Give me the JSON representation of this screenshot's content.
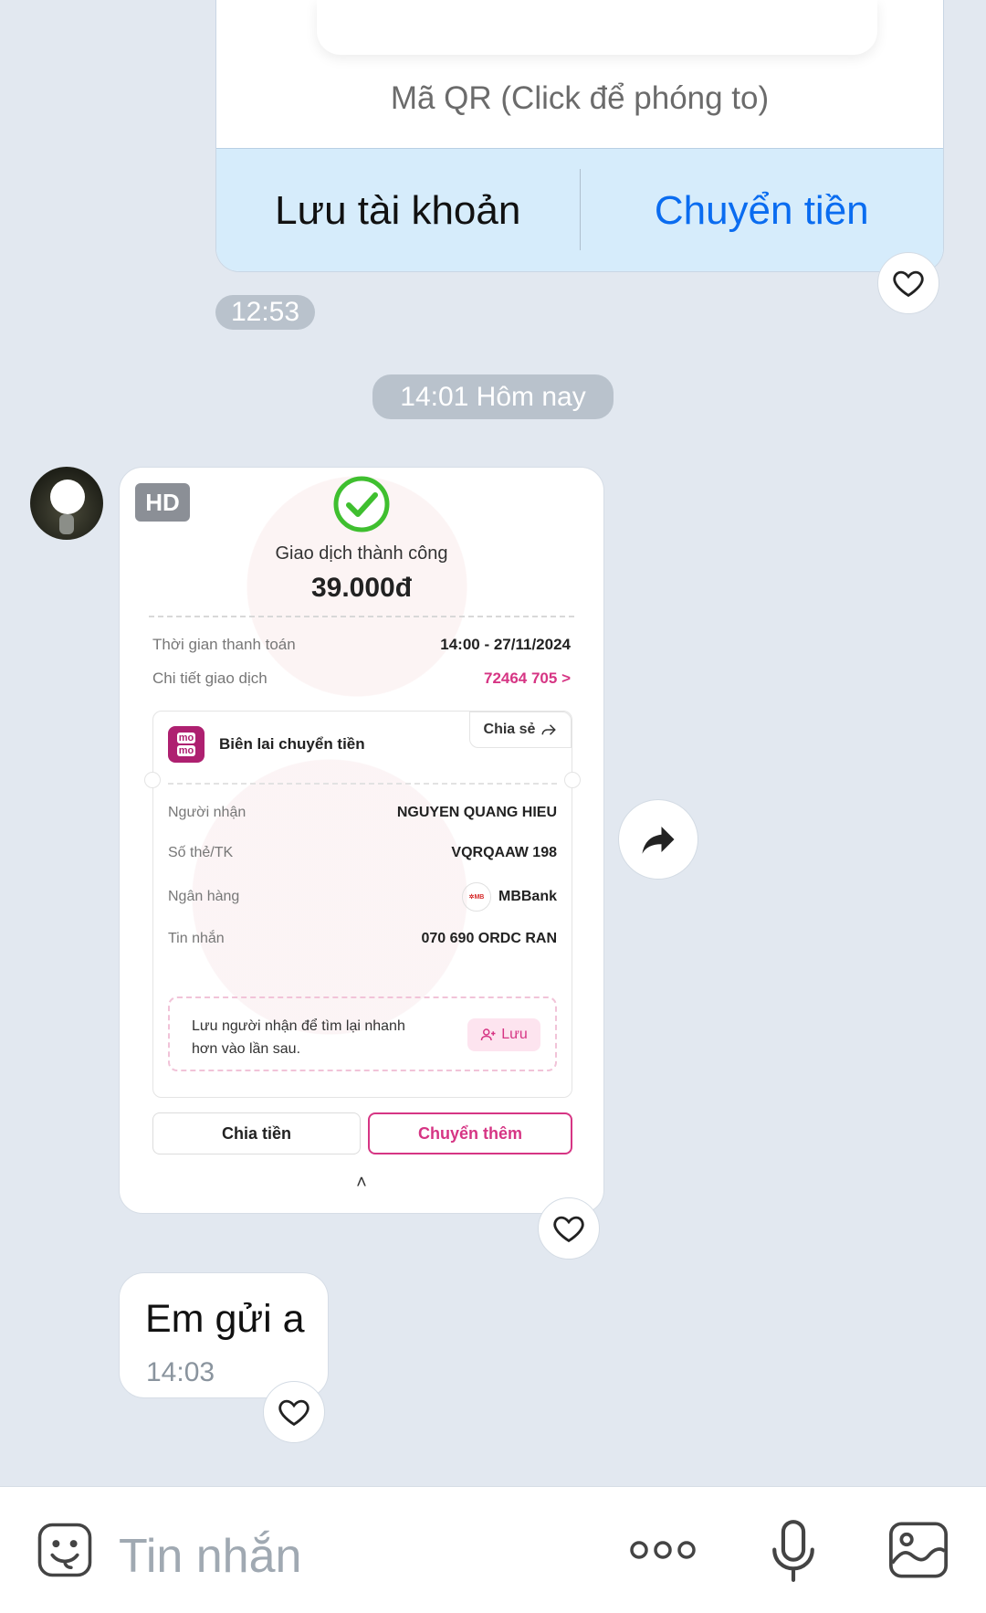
{
  "qr_card": {
    "caption": "Mã QR (Click để phóng to)",
    "save_account_label": "Lưu tài khoản",
    "transfer_label": "Chuyển tiền",
    "time": "12:53"
  },
  "date_separator": "14:01 Hôm nay",
  "receipt_image": {
    "badge": "HD",
    "status": "Giao dịch thành công",
    "amount": "39.000đ",
    "rows": [
      {
        "key": "Thời gian thanh toán",
        "value": "14:00 - 27/11/2024"
      },
      {
        "key": "Chi tiết giao dịch",
        "value": "72464    705 >"
      }
    ],
    "box": {
      "brand": "momo",
      "title": "Biên lai chuyển tiền",
      "share_label": "Chia sẻ",
      "rows": [
        {
          "key": "Người nhận",
          "value": "NGUYEN QUANG HIEU"
        },
        {
          "key": "Số thẻ/TK",
          "value": "VQRQAAW    198"
        },
        {
          "key": "Ngân hàng",
          "value": "MBBank"
        },
        {
          "key": "Tin nhắn",
          "value": "070    690    ORDC    RAN"
        }
      ],
      "save_hint": "Lưu người nhận để tìm lại nhanh hơn vào lần sau.",
      "save_button": "Lưu"
    },
    "split_button": "Chia tiền",
    "more_button": "Chuyển thêm",
    "caret": "˄"
  },
  "text_message": {
    "text": "Em gửi a",
    "time": "14:03"
  },
  "composer": {
    "placeholder": "Tin nhắn"
  },
  "colors": {
    "background": "#e2e8f0",
    "accent_blue": "#0a6cf0",
    "momo_pink": "#d63584",
    "success_green": "#3fbf2f"
  }
}
